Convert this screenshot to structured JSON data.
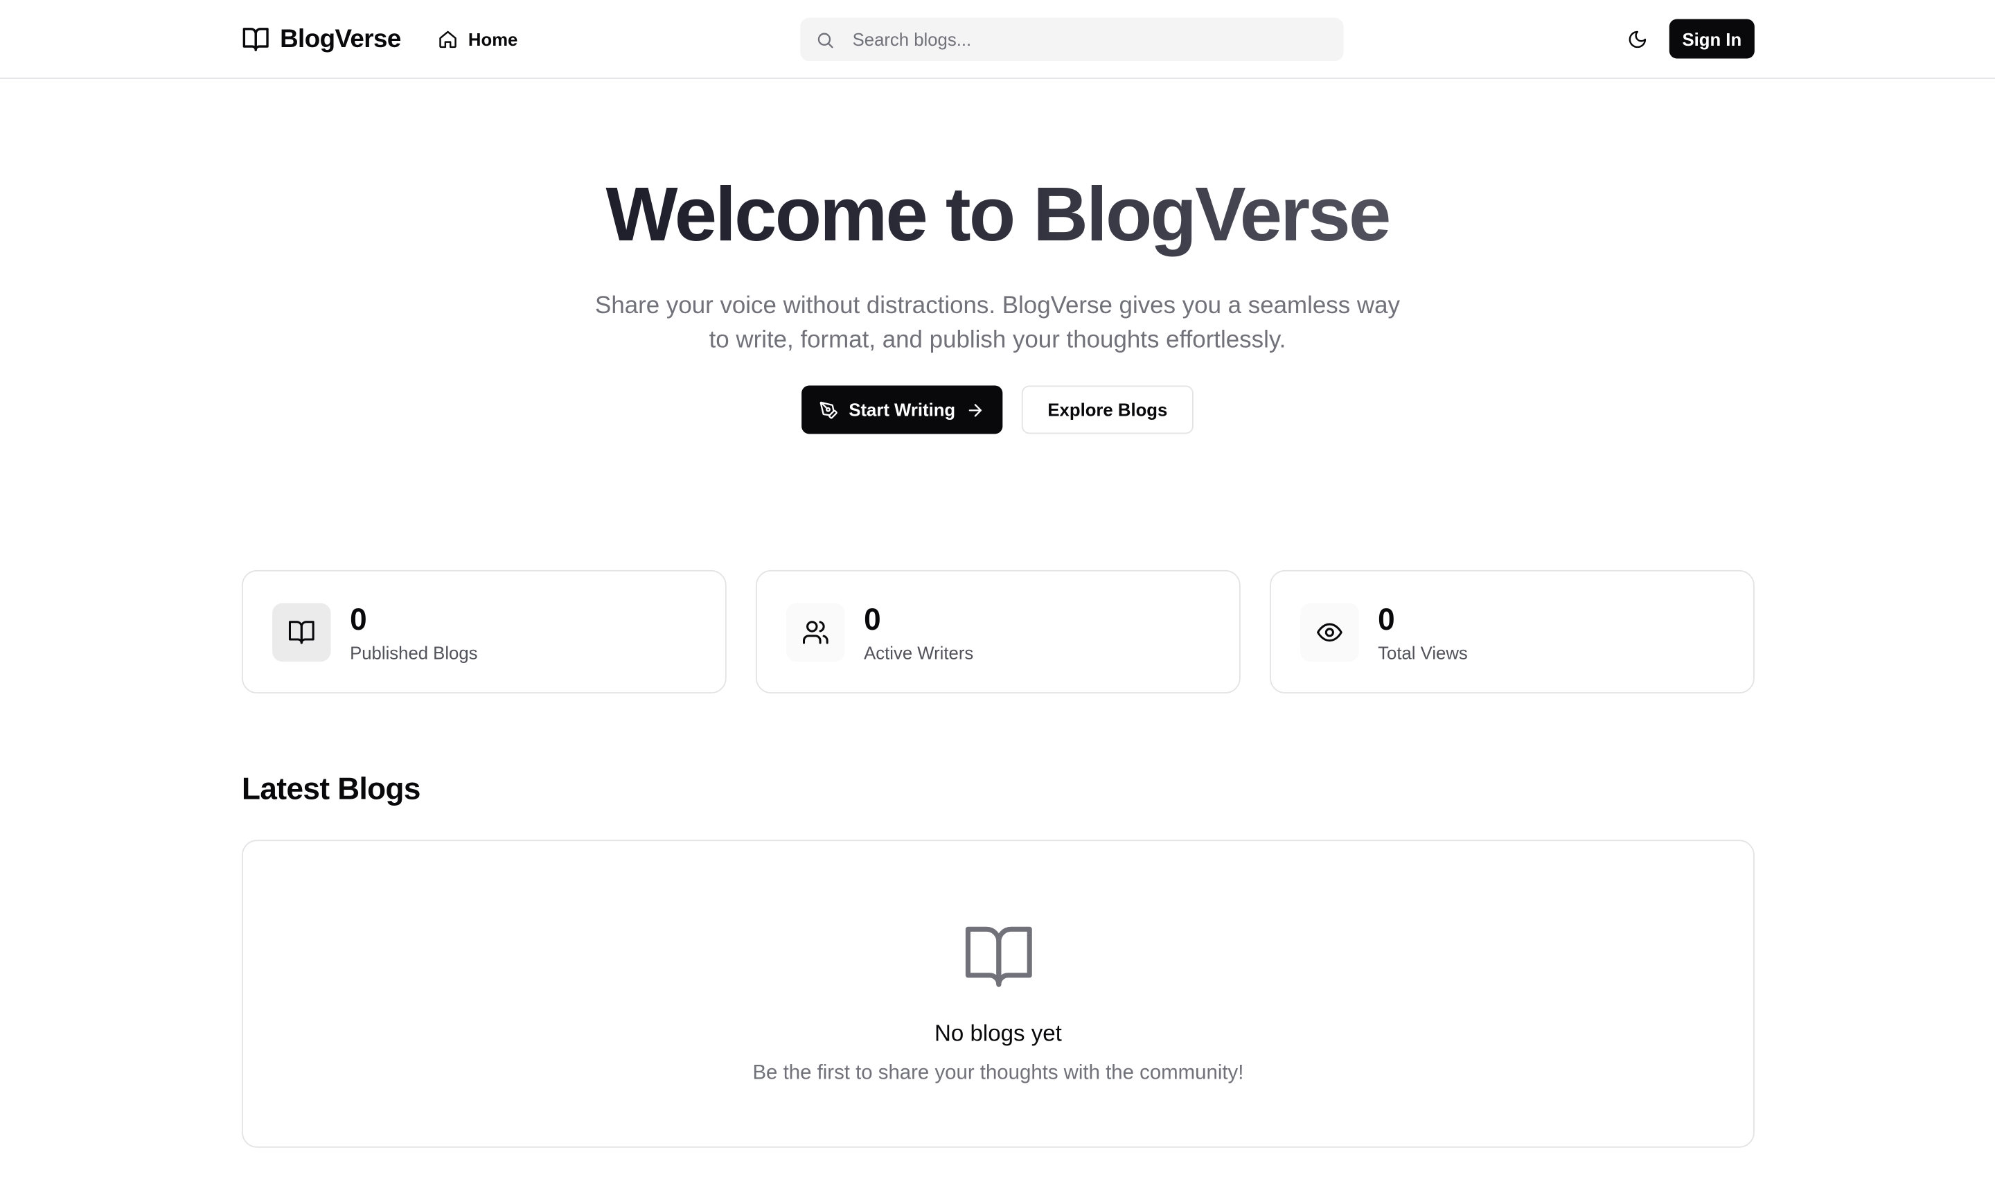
{
  "header": {
    "brand": "BlogVerse",
    "nav_home": "Home",
    "search_placeholder": "Search blogs...",
    "sign_in": "Sign In"
  },
  "hero": {
    "title": "Welcome to BlogVerse",
    "subtitle": "Share your voice without distractions. BlogVerse gives you a seamless way to write, format, and publish your thoughts effortlessly.",
    "primary_button": "Start Writing",
    "secondary_button": "Explore Blogs"
  },
  "stats": [
    {
      "value": "0",
      "label": "Published Blogs",
      "icon": "book-open-icon"
    },
    {
      "value": "0",
      "label": "Active Writers",
      "icon": "users-icon"
    },
    {
      "value": "0",
      "label": "Total Views",
      "icon": "eye-icon"
    }
  ],
  "latest": {
    "title": "Latest Blogs",
    "empty_title": "No blogs yet",
    "empty_text": "Be the first to share your thoughts with the community!",
    "empty_icon": "book-open-icon"
  },
  "icons": {
    "brand": "book-open-icon",
    "home": "home-icon",
    "search": "search-icon",
    "theme": "moon-icon",
    "start_writing": "pen-tool-icon",
    "arrow": "arrow-right-icon"
  },
  "colors": {
    "primary": "#09090b",
    "muted_text": "#71717a",
    "border": "#e4e4e7",
    "surface_muted": "#f4f4f5"
  }
}
